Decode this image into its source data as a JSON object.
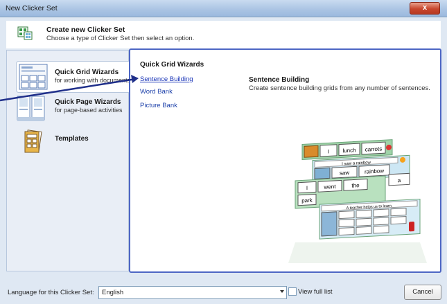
{
  "window": {
    "title": "New Clicker Set",
    "close_label": "x"
  },
  "header": {
    "title": "Create new Clicker Set",
    "subtitle": "Choose a type of Clicker Set then select an option."
  },
  "wizards": [
    {
      "title": "Quick Grid Wizards",
      "subtitle": "for working with documents"
    },
    {
      "title": "Quick Page Wizards",
      "subtitle": "for page-based activities"
    },
    {
      "title": "Templates",
      "subtitle": ""
    }
  ],
  "right": {
    "heading": "Quick Grid Wizards",
    "options": [
      "Sentence Building",
      "Word Bank",
      "Picture Bank"
    ],
    "description_title": "Sentence Building",
    "description_text": "Create sentence building grids from any number of sentences."
  },
  "illustration": {
    "words": [
      "I",
      "lunch",
      "carrots",
      "saw",
      "rainbow",
      "a",
      "I",
      "went",
      "the",
      "park"
    ],
    "caption1": "I saw a rainbow",
    "caption2": "A teacher helps us to learn."
  },
  "bottom": {
    "language_label": "Language for this Clicker Set:",
    "language_value": "English",
    "view_full_list_label": "View full list",
    "cancel_label": "Cancel"
  },
  "colors": {
    "accent": "#4d66c4",
    "link": "#1b3fa9",
    "panel_bg": "#e9eef6"
  }
}
